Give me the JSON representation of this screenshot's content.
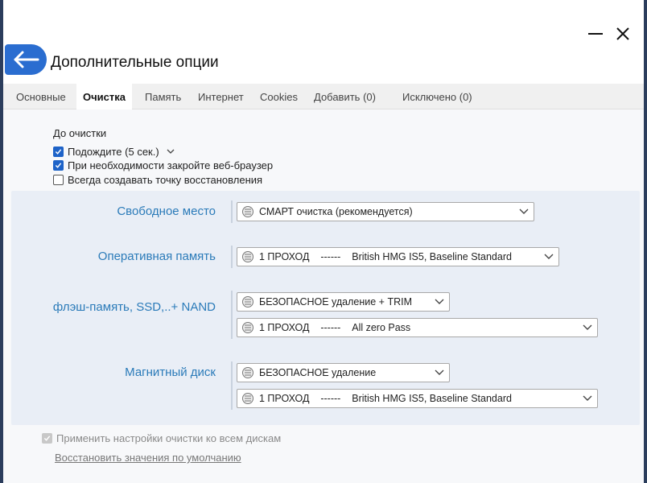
{
  "window": {
    "title": "Дополнительные опции"
  },
  "tabs": [
    {
      "label": "Основные",
      "active": false
    },
    {
      "label": "Очистка",
      "active": true
    },
    {
      "label": "Память",
      "active": false
    },
    {
      "label": "Интернет",
      "active": false
    },
    {
      "label": "Cookies",
      "active": false
    },
    {
      "label": "Добавить (0)",
      "active": false
    },
    {
      "label": "Исключено (0)",
      "active": false
    }
  ],
  "before_cleanup": {
    "heading": "До очистки",
    "options": [
      {
        "label": "Подождите (5 сек.)",
        "checked": true,
        "has_dropdown": true
      },
      {
        "label": "При необходимости закройте веб-браузер",
        "checked": true
      },
      {
        "label": "Всегда создавать точку восстановления",
        "checked": false
      }
    ]
  },
  "sections": {
    "free_space": {
      "label": "Свободное место",
      "method": "СМАРТ очистка (рекомендуется)"
    },
    "ram": {
      "label": "Оперативная память",
      "method": "1 ПРОХОД    ------    British HMG IS5, Baseline Standard"
    },
    "flash": {
      "label": "флэш-память, SSD,..+ NAND",
      "mode": "БЕЗОПАСНОЕ удаление + TRIM",
      "method": "1 ПРОХОД    ------    All zero Pass"
    },
    "hdd": {
      "label": "Магнитный диск",
      "mode": "БЕЗОПАСНОЕ удаление",
      "method": "1 ПРОХОД    ------    British HMG IS5, Baseline Standard"
    }
  },
  "apply_all": {
    "label": "Применить настройки очистки ко всем дискам",
    "checked": true,
    "disabled": true
  },
  "restore_defaults": "Восстановить значения по умолчанию",
  "colors": {
    "accent": "#2a6dd0",
    "section_label": "#2b7bb9",
    "panel_bg": "#e9eef6"
  }
}
